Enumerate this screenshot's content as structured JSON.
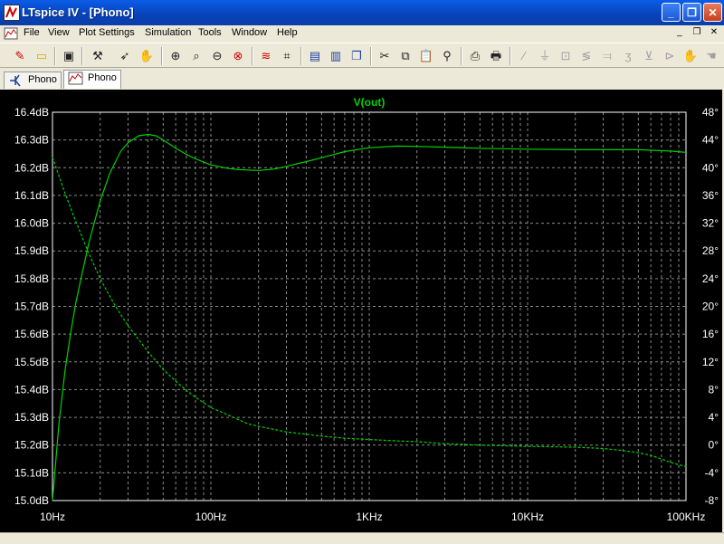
{
  "window": {
    "title": "LTspice IV - [Phono]"
  },
  "menu": {
    "items": [
      "File",
      "View",
      "Plot Settings",
      "Simulation",
      "Tools",
      "Window",
      "Help"
    ]
  },
  "toolbar": {
    "buttons": [
      "new-schematic",
      "open",
      "save",
      "control-panel",
      "run",
      "halt",
      "zoom-in",
      "pan",
      "zoom-out",
      "zoom-fit",
      "autoscale",
      "delete-trace",
      "tile-horizontal",
      "tile-vertical",
      "cascade",
      "cut",
      "copy",
      "paste",
      "find",
      "print-preview",
      "print",
      "wire",
      "ground",
      "label",
      "resistor",
      "capacitor",
      "inductor",
      "diode",
      "component",
      "move",
      "drag"
    ]
  },
  "tabs": [
    {
      "label": "Phono",
      "kind": "schematic"
    },
    {
      "label": "Phono",
      "kind": "waveform"
    }
  ],
  "chart_data": {
    "type": "line",
    "title": "V(out)",
    "xscale": "log",
    "xlim": [
      10,
      100000
    ],
    "xticks": [
      "10Hz",
      "100Hz",
      "1KHz",
      "10KHz",
      "100KHz"
    ],
    "ylim_left": [
      15.0,
      16.4
    ],
    "yticks_left": [
      "16.4dB",
      "16.3dB",
      "16.2dB",
      "16.1dB",
      "16.0dB",
      "15.9dB",
      "15.8dB",
      "15.7dB",
      "15.6dB",
      "15.5dB",
      "15.4dB",
      "15.3dB",
      "15.2dB",
      "15.1dB",
      "15.0dB"
    ],
    "ylim_right": [
      -8,
      48
    ],
    "yticks_right": [
      "48°",
      "44°",
      "40°",
      "36°",
      "32°",
      "28°",
      "24°",
      "20°",
      "16°",
      "12°",
      "8°",
      "4°",
      "0°",
      "-4°",
      "-8°"
    ],
    "grid": true,
    "colors": {
      "trace": "#00d200",
      "background": "#000000",
      "grid": "#8a8a8a",
      "axis_text": "#ffffff"
    },
    "series": [
      {
        "axis": "left",
        "style": "solid",
        "x": [
          10,
          11,
          12,
          13,
          14,
          15,
          17,
          20,
          23,
          27,
          30,
          35,
          40,
          45,
          50,
          60,
          70,
          80,
          100,
          130,
          150,
          200,
          250,
          300,
          400,
          500,
          700,
          1000,
          1500,
          2000,
          3000,
          5000,
          10000,
          20000,
          50000,
          80000,
          100000
        ],
        "values": [
          15.0,
          15.28,
          15.47,
          15.6,
          15.71,
          15.79,
          15.93,
          16.08,
          16.18,
          16.26,
          16.29,
          16.315,
          16.32,
          16.315,
          16.3,
          16.27,
          16.248,
          16.232,
          16.21,
          16.197,
          16.193,
          16.19,
          16.195,
          16.205,
          16.222,
          16.236,
          16.258,
          16.272,
          16.278,
          16.277,
          16.274,
          16.27,
          16.267,
          16.265,
          16.265,
          16.26,
          16.255
        ]
      },
      {
        "axis": "right",
        "style": "dashed",
        "x": [
          10,
          12,
          14,
          17,
          20,
          25,
          30,
          40,
          50,
          60,
          70,
          80,
          100,
          130,
          170,
          200,
          300,
          500,
          700,
          1000,
          1500,
          2000,
          3000,
          5000,
          10000,
          20000,
          30000,
          40000,
          50000,
          60000,
          70000,
          80000,
          100000
        ],
        "values": [
          41.5,
          36.3,
          32.3,
          27.6,
          24.0,
          20.0,
          17.2,
          13.5,
          10.9,
          9.2,
          7.9,
          6.9,
          5.4,
          4.3,
          3.1,
          2.7,
          1.9,
          1.3,
          1.0,
          0.8,
          0.6,
          0.5,
          0.2,
          0.0,
          -0.2,
          -0.3,
          -0.5,
          -0.8,
          -1.1,
          -1.5,
          -2.0,
          -2.5,
          -3.1
        ]
      }
    ]
  }
}
